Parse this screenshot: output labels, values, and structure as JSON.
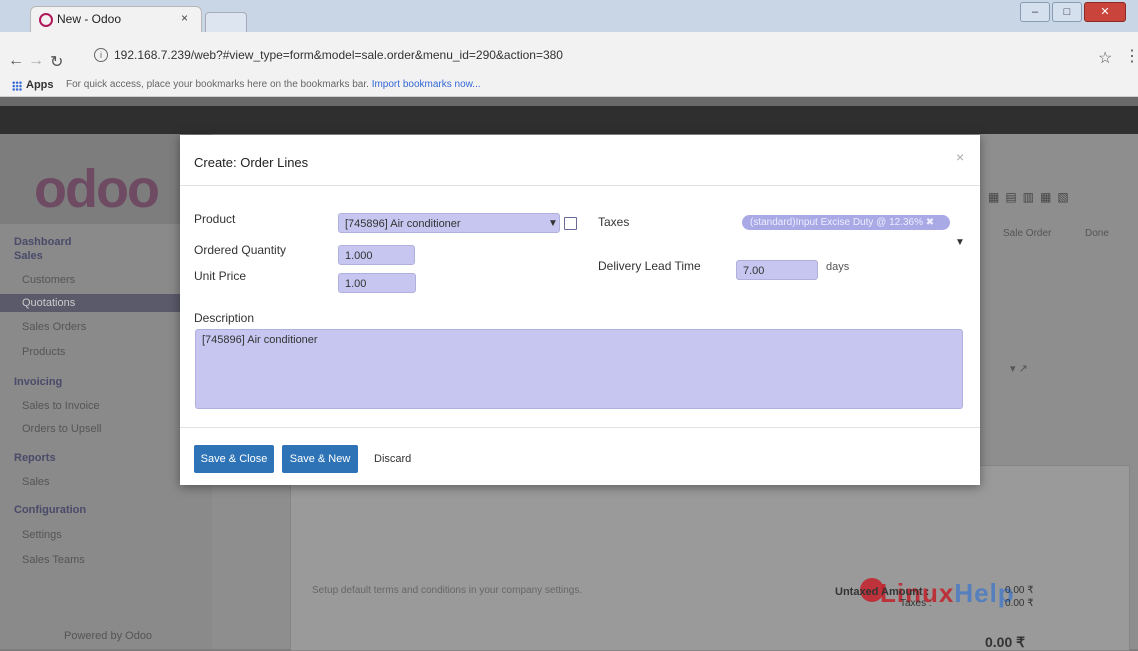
{
  "browser": {
    "tab_title": "New - Odoo",
    "tab_close": "×",
    "url": "192.168.7.239/web?#view_type=form&model=sale.order&menu_id=290&action=380",
    "bookmarks_apps": "Apps",
    "bookmarks_text": "For quick access, place your bookmarks here on the bookmarks bar.",
    "bookmarks_link": "Import bookmarks now..."
  },
  "odoo_bg": {
    "logo": "odoo",
    "sidebar": {
      "dashboard": "Dashboard",
      "sales": "Sales",
      "customers": "Customers",
      "quotations": "Quotations",
      "sales_orders": "Sales Orders",
      "products": "Products",
      "invoicing": "Invoicing",
      "sales_to_invoice": "Sales to Invoice",
      "orders_to_upsell": "Orders to Upsell",
      "reports": "Reports",
      "reports_sales": "Sales",
      "configuration": "Configuration",
      "settings": "Settings",
      "sales_teams": "Sales Teams",
      "powered": "Powered by Odoo"
    },
    "header_sale_order": "Sale Order",
    "header_done": "Done",
    "terms_note": "Setup default terms and conditions in your company settings.",
    "untaxed_amount": "Untaxed Amount :",
    "taxes": "Taxes :",
    "amount1": "0.00 ₹",
    "amount2": "0.00 ₹",
    "total": "0.00 ₹"
  },
  "watermark": {
    "linux": "Linux",
    "help": "Help"
  },
  "modal": {
    "title": "Create: Order Lines",
    "close": "×",
    "product_label": "Product",
    "product_value": "[745896] Air conditioner",
    "ordered_qty_label": "Ordered Quantity",
    "ordered_qty_value": "1.000",
    "unit_price_label": "Unit Price",
    "unit_price_value": "1.00",
    "taxes_label": "Taxes",
    "taxes_tag": "(standard)Input Excise Duty @ 12.36%",
    "lead_time_label": "Delivery Lead Time",
    "lead_time_value": "7.00",
    "lead_time_unit": "days",
    "description_label": "Description",
    "description_value": "[745896] Air conditioner",
    "btn_save_close": "Save & Close",
    "btn_save_new": "Save & New",
    "btn_discard": "Discard"
  }
}
